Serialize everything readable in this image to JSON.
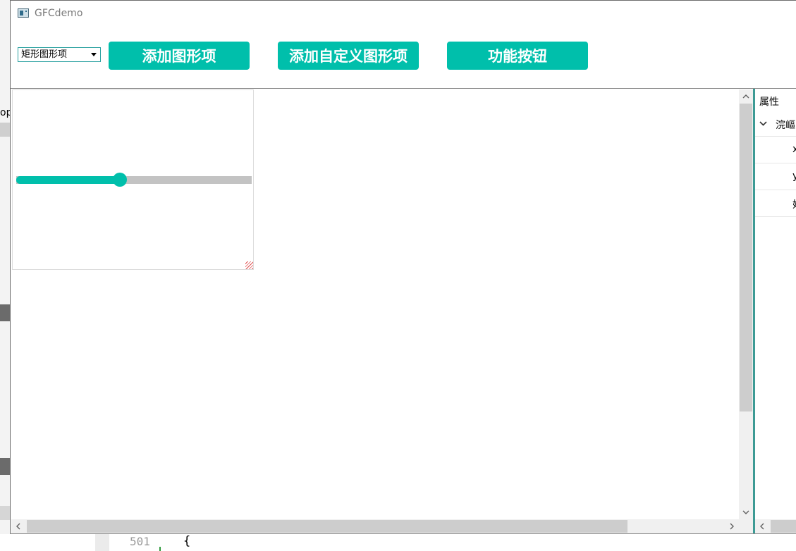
{
  "window": {
    "title": "GFCdemo"
  },
  "toolbar": {
    "shape_select": {
      "selected": "矩形图形项"
    },
    "buttons": [
      {
        "label": "添加图形项"
      },
      {
        "label": "添加自定义图形项"
      },
      {
        "label": "功能按钮"
      }
    ],
    "accent_color": "#00bfab"
  },
  "canvas": {
    "slider": {
      "value_fraction": 0.44
    }
  },
  "properties": {
    "title": "属性",
    "group_label": "浣嶇",
    "rows": [
      {
        "label": "x"
      },
      {
        "label": "y"
      },
      {
        "label": "妤"
      }
    ]
  },
  "background": {
    "left_fragment": "op",
    "editor_line_number": "501",
    "editor_text": "{"
  },
  "icons": {
    "app": "app-window-icon",
    "scroll_up": "arrow-up-icon",
    "scroll_down": "arrow-down-icon",
    "scroll_left": "arrow-left-icon",
    "scroll_right": "arrow-right-icon",
    "group_toggle": "chevron-down-icon"
  }
}
